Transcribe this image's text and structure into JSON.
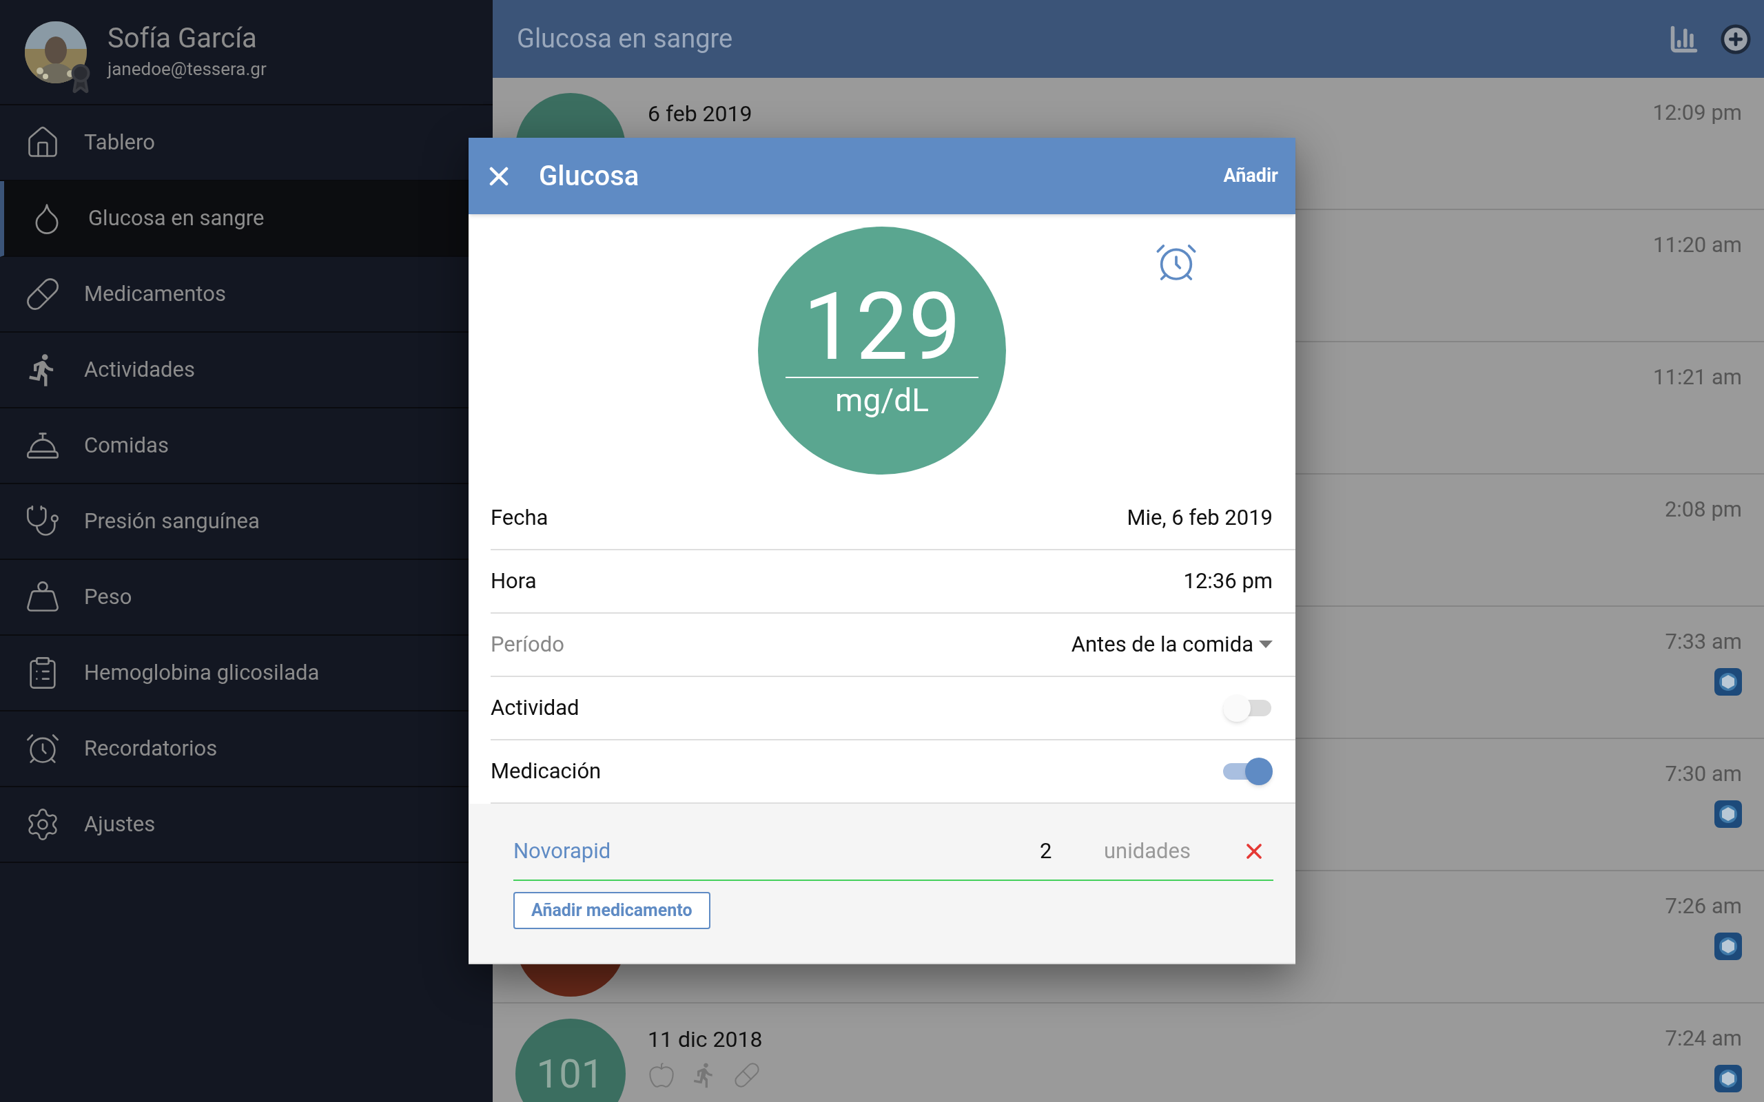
{
  "sidebar": {
    "user": {
      "name": "Sofía García",
      "email": "janedoe@tessera.gr"
    },
    "items": [
      {
        "label": "Tablero",
        "kind": "home",
        "selected": false
      },
      {
        "label": "Glucosa en sangre",
        "kind": "drop",
        "selected": true
      },
      {
        "label": "Medicamentos",
        "kind": "medication",
        "selected": false
      },
      {
        "label": "Actividades",
        "kind": "activity",
        "selected": false
      },
      {
        "label": "Comidas",
        "kind": "food",
        "selected": false
      },
      {
        "label": "Presión sanguínea",
        "kind": "pressure",
        "selected": false
      },
      {
        "label": "Peso",
        "kind": "weight",
        "selected": false
      },
      {
        "label": "Hemoglobina glicosilada",
        "kind": "clipboard",
        "selected": false
      },
      {
        "label": "Recordatorios",
        "kind": "alarm",
        "selected": false
      },
      {
        "label": "Ajustes",
        "kind": "settings",
        "selected": false
      }
    ]
  },
  "header": {
    "title": "Glucosa en sangre"
  },
  "entries": [
    {
      "date": "6 feb 2019",
      "time": "12:09 pm",
      "color": "#3b6e60",
      "device": false
    },
    {
      "time": "11:20 am",
      "device": false
    },
    {
      "time": "11:21 am",
      "device": false
    },
    {
      "time": "2:08 pm",
      "device": false
    },
    {
      "time": "7:33 am",
      "device": true
    },
    {
      "time": "7:30 am",
      "device": true
    },
    {
      "time": "7:26 am",
      "color": "#6b2a1a",
      "device": true
    },
    {
      "date": "11 dic 2018",
      "time": "7:24 am",
      "value": "101",
      "color": "#3b6e60",
      "device": true,
      "tags": [
        {
          "kind": "food"
        },
        {
          "kind": "activity"
        },
        {
          "kind": "medication"
        }
      ]
    }
  ],
  "dialog": {
    "title": "Glucosa",
    "action": "Añadir",
    "reading": {
      "value": "129",
      "unit": "mg/dL"
    },
    "fields": [
      {
        "kind": "text",
        "label": "Fecha",
        "value": "Mie, 6 feb 2019"
      },
      {
        "kind": "text",
        "label": "Hora",
        "value": "12:36 pm"
      },
      {
        "kind": "select",
        "label": "Período",
        "value": "Antes de la comida"
      },
      {
        "kind": "toggle",
        "label": "Actividad",
        "on": false
      },
      {
        "kind": "toggle",
        "label": "Medicación",
        "on": true
      }
    ],
    "medications": [
      {
        "name": "Novorapid",
        "amount": "2",
        "unit": "unidades"
      }
    ],
    "add_medication": "Añadir medicamento"
  }
}
